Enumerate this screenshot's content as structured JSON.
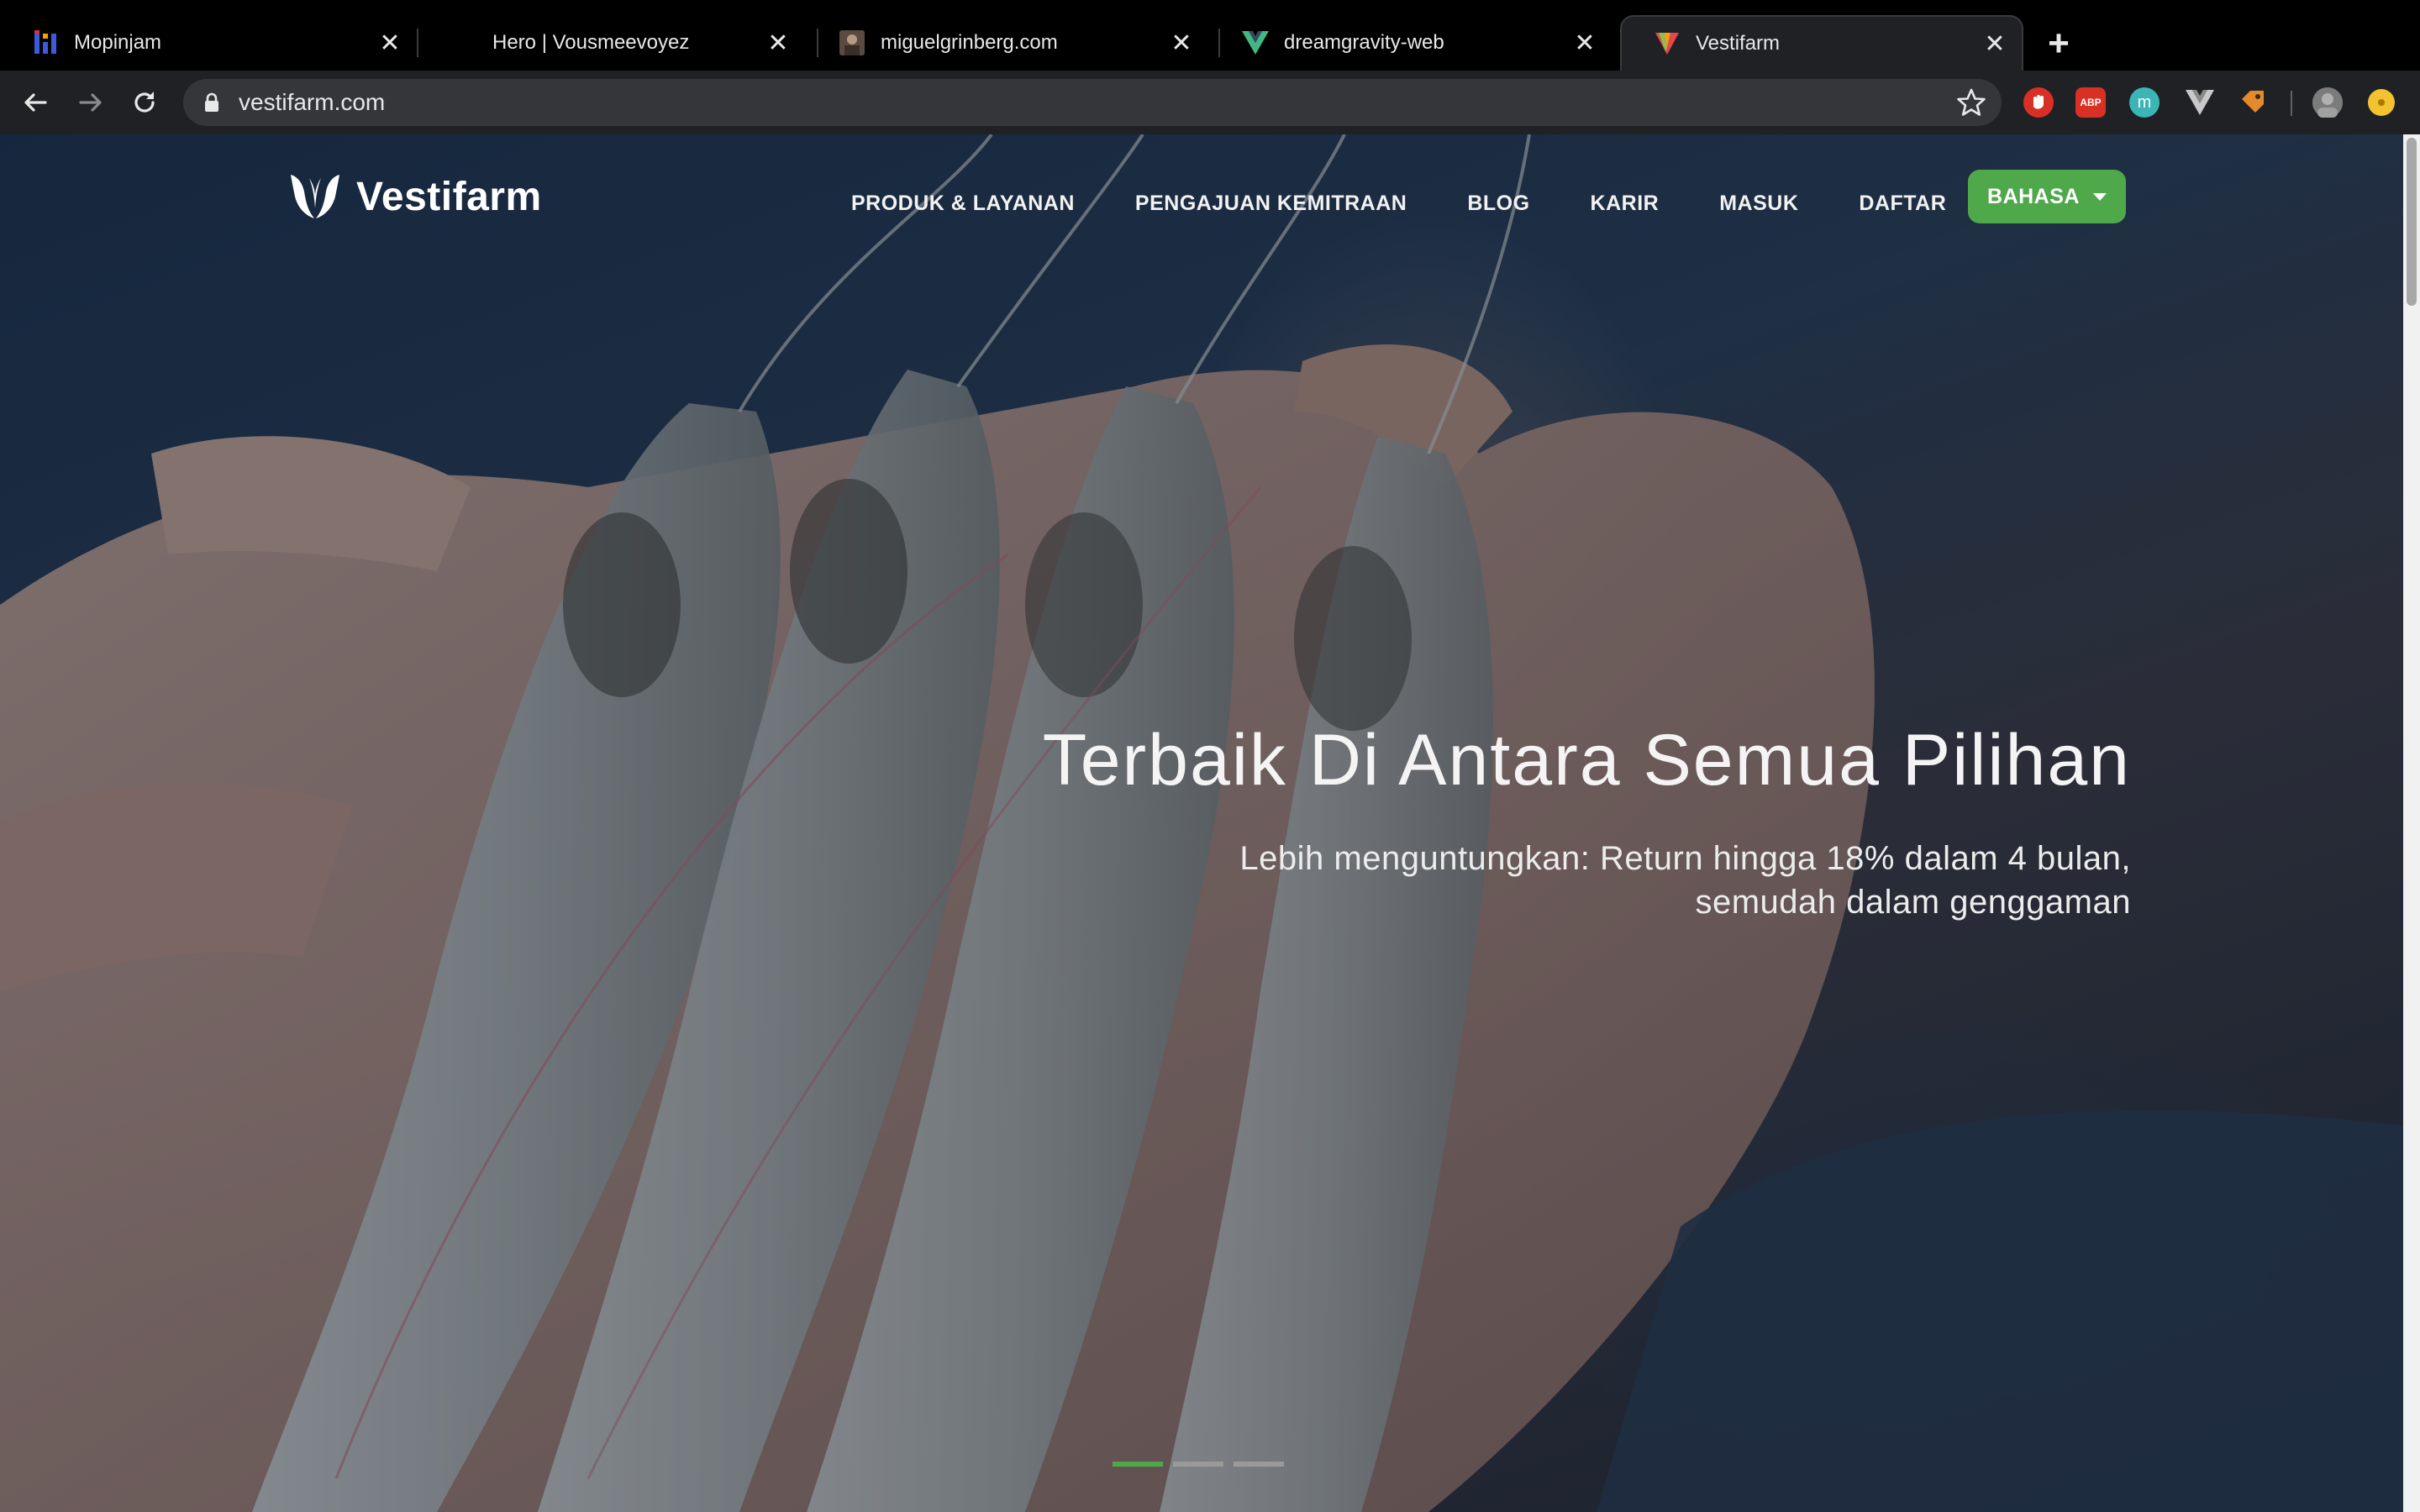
{
  "browser": {
    "tabs": [
      {
        "title": "Mopinjam",
        "close": "✕",
        "icon": "mopinjam-favicon"
      },
      {
        "title": "Hero | Vousmeevoyez",
        "close": "✕",
        "icon": "blank-favicon"
      },
      {
        "title": "miguelgrinberg.com",
        "close": "✕",
        "icon": "avatar-favicon"
      },
      {
        "title": "dreamgravity-web",
        "close": "✕",
        "icon": "vue-favicon"
      },
      {
        "title": "Vestifarm",
        "close": "✕",
        "icon": "vestifarm-favicon",
        "active": true
      }
    ],
    "new_tab": "+",
    "url": "vestifarm.com",
    "extensions": [
      "stop-extension-icon",
      "adblock-extension-icon",
      "teal-extension-icon",
      "vue-devtools-icon",
      "tag-extension-icon",
      "profile-avatar-icon",
      "coin-extension-icon"
    ],
    "extension_labels": {
      "adblock": "ABP",
      "teal": "m"
    }
  },
  "site": {
    "logo_text": "Vestifarm",
    "nav": [
      "PRODUK & LAYANAN",
      "PENGAJUAN KEMITRAAN",
      "BLOG",
      "KARIR",
      "MASUK",
      "DAFTAR"
    ],
    "language_button": "BAHASA",
    "hero": {
      "title": "Terbaik Di Antara Semua Pilihan",
      "subtitle_line1": "Lebih menguntungkan: Return hingga 18% dalam 4 bulan,",
      "subtitle_line2": "semudah dalam genggaman"
    },
    "carousel": {
      "slides": 3,
      "active_index": 0
    }
  },
  "colors": {
    "accent_green": "#4fa84a",
    "chrome_bg": "#202124",
    "omnibox_bg": "#35363a"
  }
}
